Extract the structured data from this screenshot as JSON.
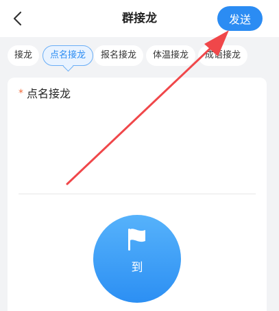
{
  "header": {
    "title": "群接龙",
    "send_label": "发送"
  },
  "tabs": [
    {
      "label": "接龙",
      "active": false
    },
    {
      "label": "点名接龙",
      "active": true
    },
    {
      "label": "报名接龙",
      "active": false
    },
    {
      "label": "体温接龙",
      "active": false
    },
    {
      "label": "成语接龙",
      "active": false
    }
  ],
  "form": {
    "required_mark": "*",
    "field_label": "点名接龙"
  },
  "checkin_button": {
    "label": "到"
  },
  "colors": {
    "accent": "#2b8cf3",
    "required": "#f06a3a",
    "annotation_arrow": "#f0474a"
  }
}
